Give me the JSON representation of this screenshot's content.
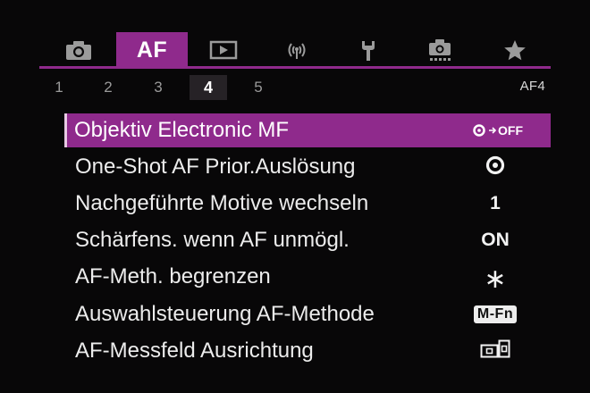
{
  "tabs": [
    {
      "id": "shooting",
      "icon": "camera-icon",
      "label": ""
    },
    {
      "id": "af",
      "icon": "",
      "label": "AF",
      "active": true
    },
    {
      "id": "playback",
      "icon": "playback-icon",
      "label": ""
    },
    {
      "id": "wireless",
      "icon": "wireless-icon",
      "label": ""
    },
    {
      "id": "setup",
      "icon": "wrench-icon",
      "label": ""
    },
    {
      "id": "custom",
      "icon": "custom-camera-icon",
      "label": ""
    },
    {
      "id": "mymenu",
      "icon": "star-icon",
      "label": ""
    }
  ],
  "pages": [
    "1",
    "2",
    "3",
    "4",
    "5"
  ],
  "active_page": "4",
  "page_label": "AF4",
  "menu": [
    {
      "label": "Objektiv Electronic MF",
      "value": "OFF",
      "value_icon": "lens-electronic-mf-icon",
      "selected": true
    },
    {
      "label": "One-Shot AF Prior.Auslösung",
      "value": "",
      "value_icon": "focus-priority-icon"
    },
    {
      "label": "Nachgeführte Motive wechseln",
      "value": "1",
      "value_icon": ""
    },
    {
      "label": "Schärfens. wenn AF unmögl.",
      "value": "ON",
      "value_icon": ""
    },
    {
      "label": "AF-Meth. begrenzen",
      "value": "∗",
      "value_icon": "asterisk-icon"
    },
    {
      "label": "Auswahlsteuerung AF-Methode",
      "value": "M-Fn",
      "value_icon": ""
    },
    {
      "label": "AF-Messfeld Ausrichtung",
      "value": "",
      "value_icon": "af-point-orientation-icon"
    }
  ],
  "colors": {
    "accent": "#8f2a8c",
    "background": "#080708",
    "text": "#ececec",
    "inactive_icon": "#9b9b9b"
  }
}
